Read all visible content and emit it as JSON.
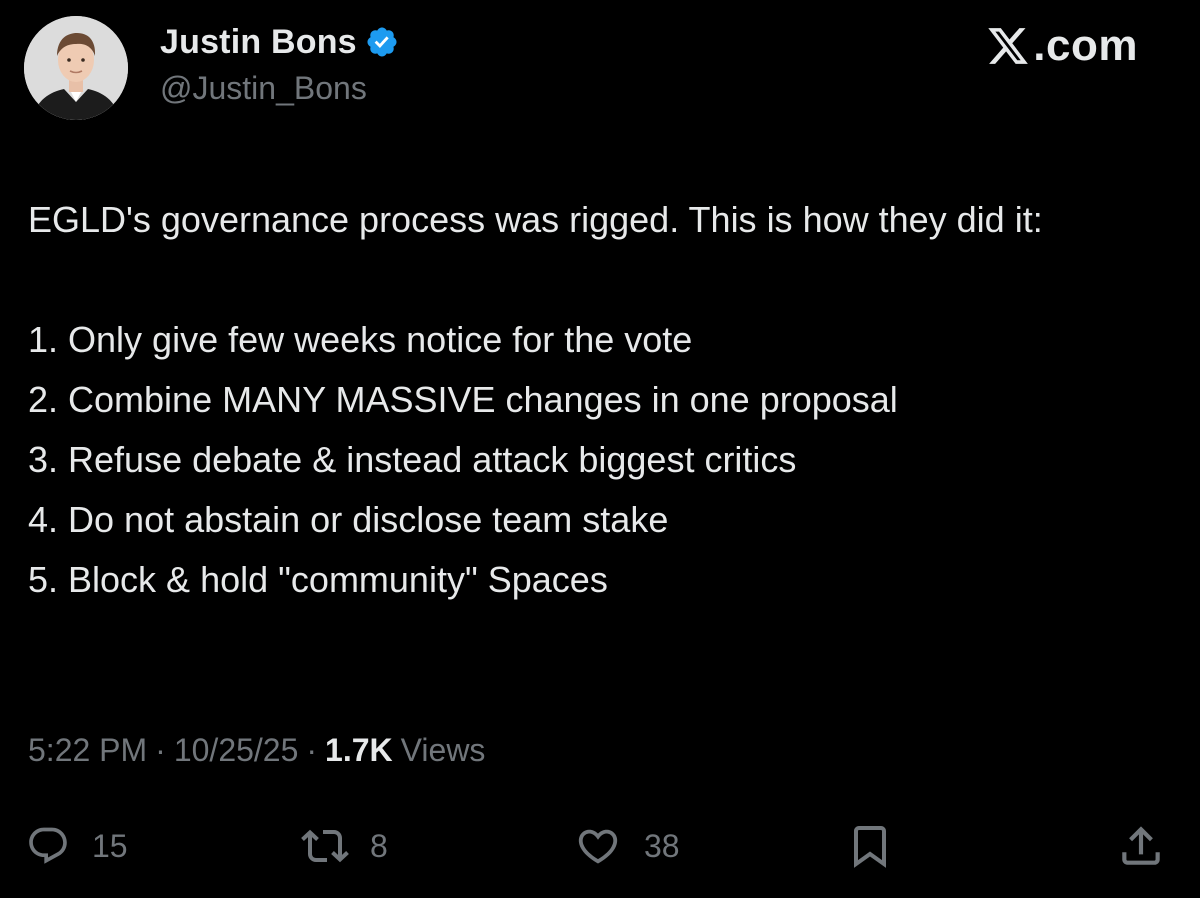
{
  "author": {
    "display_name": "Justin Bons",
    "handle": "@Justin_Bons",
    "verified_icon": "verified-badge-icon",
    "badge_color": "#1d9bf0"
  },
  "brand": {
    "icon": "x-logo-icon",
    "text": ".com"
  },
  "tweet": {
    "lines": [
      "EGLD's governance process was rigged. This is how they did it:",
      "1. Only give few weeks notice for the vote",
      "2. Combine MANY MASSIVE changes in one proposal",
      "3. Refuse debate & instead attack biggest critics",
      "4. Do not abstain or disclose team stake",
      "5. Block & hold \"community\" Spaces"
    ]
  },
  "meta": {
    "time": "5:22 PM",
    "separator": "·",
    "date": "10/25/25",
    "views_count": "1.7K",
    "views_label": "Views"
  },
  "actions": {
    "reply": {
      "icon": "reply-icon",
      "count": "15"
    },
    "repost": {
      "icon": "repost-icon",
      "count": "8"
    },
    "like": {
      "icon": "heart-icon",
      "count": "38"
    },
    "bookmark": {
      "icon": "bookmark-icon"
    },
    "share": {
      "icon": "share-icon"
    }
  },
  "colors": {
    "background": "#000000",
    "text_primary": "#e7e9ea",
    "text_secondary": "#71767b",
    "verified_blue": "#1d9bf0"
  }
}
